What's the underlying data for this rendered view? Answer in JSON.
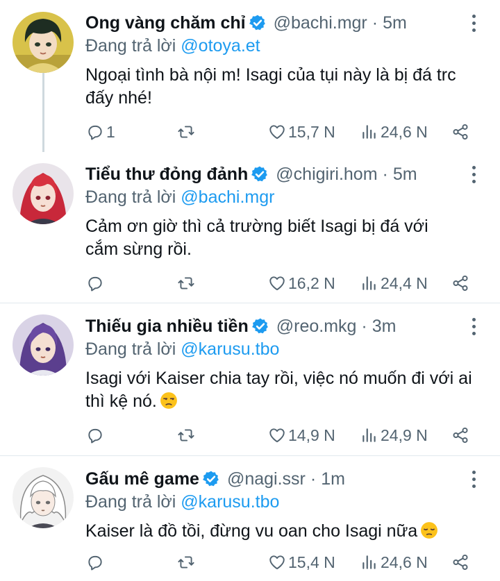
{
  "colors": {
    "accent": "#1d9bf0",
    "text": "#0f1419",
    "secondary": "#536471",
    "divider": "#e1e8ed"
  },
  "tweets": [
    {
      "name": "Ong vàng chăm chỉ",
      "handle": "@bachi.mgr",
      "separator": "·",
      "time": "5m",
      "reply_prefix": "Đang trả lời",
      "reply_to": "@otoya.et",
      "text": "Ngoại tình bà nội m! Isagi của tụi này là bị đá trc đấy nhé!",
      "emoji": "",
      "replies": "1",
      "retweets": "",
      "likes": "15,7 N",
      "views": "24,6 N",
      "avatar_icon": "avatar-dark-hair-yellow-bg"
    },
    {
      "name": "Tiểu thư đỏng đảnh",
      "handle": "@chigiri.hom",
      "separator": "·",
      "time": "5m",
      "reply_prefix": "Đang trả lời",
      "reply_to": "@bachi.mgr",
      "text": "Cảm ơn giờ thì cả trường biết Isagi bị đá với cắm sừng rồi.",
      "emoji": "",
      "replies": "",
      "retweets": "",
      "likes": "16,2 N",
      "views": "24,4 N",
      "avatar_icon": "avatar-red-hair"
    },
    {
      "name": "Thiếu gia nhiều tiền",
      "handle": "@reo.mkg",
      "separator": "·",
      "time": "3m",
      "reply_prefix": "Đang trả lời",
      "reply_to": "@karusu.tbo",
      "text": "Isagi với Kaiser chia tay rồi, việc nó muốn đi với ai thì kệ nó.",
      "emoji": "unamused-face-emoji",
      "replies": "",
      "retweets": "",
      "likes": "14,9 N",
      "views": "24,9 N",
      "avatar_icon": "avatar-purple-hair"
    },
    {
      "name": "Gấu mê game",
      "handle": "@nagi.ssr",
      "separator": "·",
      "time": "1m",
      "reply_prefix": "Đang trả lời",
      "reply_to": "@karusu.tbo",
      "text": "Kaiser là đồ tồi, đừng vu oan cho Isagi nữa",
      "emoji": "pensive-face-emoji",
      "replies": "",
      "retweets": "",
      "likes": "15,4 N",
      "views": "24,6 N",
      "avatar_icon": "avatar-white-hair"
    }
  ]
}
